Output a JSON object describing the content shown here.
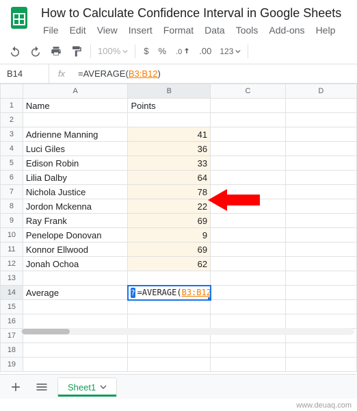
{
  "doc_title": "How to Calculate Confidence Interval in Google Sheets",
  "menus": [
    "File",
    "Edit",
    "View",
    "Insert",
    "Format",
    "Data",
    "Tools",
    "Add-ons",
    "Help"
  ],
  "toolbar": {
    "zoom": "100%",
    "currency": "$",
    "percent": "%",
    "dec_less": ".0",
    "dec_more": ".00",
    "numfmt": "123"
  },
  "namebox": "B14",
  "fx_label": "fx",
  "formula": {
    "prefix": "=AVERAGE(",
    "ref": "B3:B12",
    "suffix": ")"
  },
  "columns": [
    "A",
    "B",
    "C",
    "D"
  ],
  "headers": {
    "A": "Name",
    "B": "Points"
  },
  "rows": [
    {
      "n": 1
    },
    {
      "n": 2
    },
    {
      "n": 3,
      "A": "Adrienne Manning",
      "B": "41"
    },
    {
      "n": 4,
      "A": "Luci Giles",
      "B": "36"
    },
    {
      "n": 5,
      "A": "Edison Robin",
      "B": "33"
    },
    {
      "n": 6,
      "A": "Lilia Dalby",
      "B": "64"
    },
    {
      "n": 7,
      "A": "Nichola Justice",
      "B": "78"
    },
    {
      "n": 8,
      "A": "Jordon Mckenna",
      "B": "22"
    },
    {
      "n": 9,
      "A": "Ray Frank",
      "B": "69"
    },
    {
      "n": 10,
      "A": "Penelope Donovan",
      "B": "9"
    },
    {
      "n": 11,
      "A": "Konnor Ellwood",
      "B": "69"
    },
    {
      "n": 12,
      "A": "Jonah Ochoa",
      "B": "62"
    },
    {
      "n": 13
    },
    {
      "n": 14,
      "A": "Average"
    },
    {
      "n": 15
    },
    {
      "n": 16
    },
    {
      "n": 17
    },
    {
      "n": 18
    },
    {
      "n": 19
    }
  ],
  "active_cell": {
    "prefix": "=AVERAGE(",
    "ref": "B3:B12",
    "suffix": ")",
    "hint": "?"
  },
  "sheet_tab": "Sheet1",
  "watermark": "www.deuaq.com"
}
